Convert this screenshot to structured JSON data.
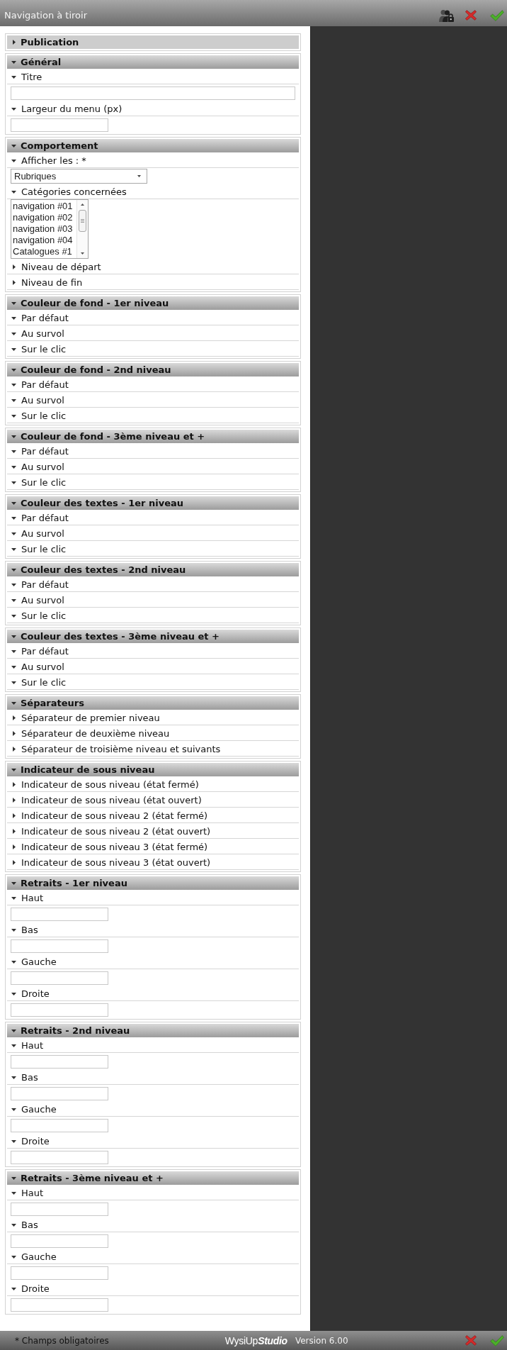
{
  "window": {
    "title": "Navigation à tiroir"
  },
  "sections": [
    {
      "title": "Publication",
      "expanded": false
    },
    {
      "title": "Général",
      "expanded": true,
      "fields": [
        {
          "label": "Titre",
          "expanded": true,
          "kind": "text"
        },
        {
          "label": "Largeur du menu (px)",
          "expanded": true,
          "kind": "number"
        }
      ]
    },
    {
      "title": "Comportement",
      "expanded": true,
      "fields": [
        {
          "label": "Afficher les : *",
          "expanded": true,
          "kind": "select",
          "value": "Rubriques"
        },
        {
          "label": "Catégories concernées",
          "expanded": true,
          "kind": "listbox",
          "options": [
            {
              "label": "navigation #01",
              "selected": false
            },
            {
              "label": "navigation #02",
              "selected": false
            },
            {
              "label": "navigation #03",
              "selected": false
            },
            {
              "label": "navigation #04",
              "selected": false
            },
            {
              "label": "Catalogues #1",
              "selected": false
            }
          ]
        },
        {
          "label": "Niveau de départ",
          "expanded": false
        },
        {
          "label": "Niveau de fin",
          "expanded": false
        }
      ]
    },
    {
      "title": "Couleur de fond - 1er niveau",
      "expanded": true,
      "fields": [
        {
          "label": "Par défaut",
          "expanded": true
        },
        {
          "label": "Au survol",
          "expanded": true
        },
        {
          "label": "Sur le clic",
          "expanded": true
        }
      ]
    },
    {
      "title": "Couleur de fond - 2nd niveau",
      "expanded": true,
      "fields": [
        {
          "label": "Par défaut",
          "expanded": true
        },
        {
          "label": "Au survol",
          "expanded": true
        },
        {
          "label": "Sur le clic",
          "expanded": true
        }
      ]
    },
    {
      "title": "Couleur de fond - 3ème niveau et +",
      "expanded": true,
      "fields": [
        {
          "label": "Par défaut",
          "expanded": true
        },
        {
          "label": "Au survol",
          "expanded": true
        },
        {
          "label": "Sur le clic",
          "expanded": true
        }
      ]
    },
    {
      "title": "Couleur des textes - 1er niveau",
      "expanded": true,
      "fields": [
        {
          "label": "Par défaut",
          "expanded": true
        },
        {
          "label": "Au survol",
          "expanded": true
        },
        {
          "label": "Sur le clic",
          "expanded": true
        }
      ]
    },
    {
      "title": "Couleur des textes - 2nd niveau",
      "expanded": true,
      "fields": [
        {
          "label": "Par défaut",
          "expanded": true
        },
        {
          "label": "Au survol",
          "expanded": true
        },
        {
          "label": "Sur le clic",
          "expanded": true
        }
      ]
    },
    {
      "title": "Couleur des textes - 3ème niveau et +",
      "expanded": true,
      "fields": [
        {
          "label": "Par défaut",
          "expanded": true
        },
        {
          "label": "Au survol",
          "expanded": true
        },
        {
          "label": "Sur le clic",
          "expanded": true
        }
      ]
    },
    {
      "title": "Séparateurs",
      "expanded": true,
      "fields": [
        {
          "label": "Séparateur de premier niveau",
          "expanded": false
        },
        {
          "label": "Séparateur de deuxième niveau",
          "expanded": false
        },
        {
          "label": "Séparateur de troisième niveau et suivants",
          "expanded": false
        }
      ]
    },
    {
      "title": "Indicateur de sous niveau",
      "expanded": true,
      "fields": [
        {
          "label": "Indicateur de sous niveau (état fermé)",
          "expanded": false
        },
        {
          "label": "Indicateur de sous niveau (état ouvert)",
          "expanded": false
        },
        {
          "label": "Indicateur de sous niveau 2 (état fermé)",
          "expanded": false
        },
        {
          "label": "Indicateur de sous niveau 2 (état ouvert)",
          "expanded": false
        },
        {
          "label": "Indicateur de sous niveau 3 (état fermé)",
          "expanded": false
        },
        {
          "label": "Indicateur de sous niveau 3 (état ouvert)",
          "expanded": false
        }
      ]
    },
    {
      "title": "Retraits - 1er niveau",
      "expanded": true,
      "fields": [
        {
          "label": "Haut",
          "expanded": true,
          "kind": "number"
        },
        {
          "label": "Bas",
          "expanded": true,
          "kind": "number"
        },
        {
          "label": "Gauche",
          "expanded": true,
          "kind": "number"
        },
        {
          "label": "Droite",
          "expanded": true,
          "kind": "number"
        }
      ]
    },
    {
      "title": "Retraits - 2nd niveau",
      "expanded": true,
      "fields": [
        {
          "label": "Haut",
          "expanded": true,
          "kind": "number"
        },
        {
          "label": "Bas",
          "expanded": true,
          "kind": "number"
        },
        {
          "label": "Gauche",
          "expanded": true,
          "kind": "number"
        },
        {
          "label": "Droite",
          "expanded": true,
          "kind": "number"
        }
      ]
    },
    {
      "title": "Retraits - 3ème niveau et +",
      "expanded": true,
      "fields": [
        {
          "label": "Haut",
          "expanded": true,
          "kind": "number"
        },
        {
          "label": "Bas",
          "expanded": true,
          "kind": "number"
        },
        {
          "label": "Gauche",
          "expanded": true,
          "kind": "number"
        },
        {
          "label": "Droite",
          "expanded": true,
          "kind": "number"
        }
      ]
    }
  ],
  "footer": {
    "note": "* Champs obligatoires",
    "logo": "WysiUp**Studio**",
    "version": "Version 6.00"
  }
}
